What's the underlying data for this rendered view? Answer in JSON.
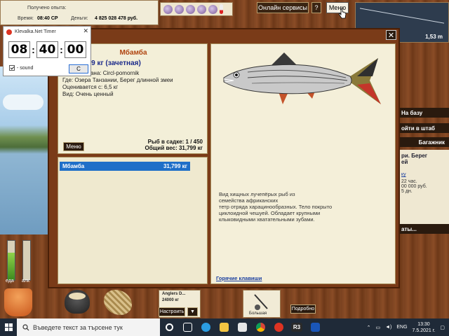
{
  "hud": {
    "experience_label": "Получено опыта:",
    "time_label": "Время:",
    "time_value": "08:40 СР",
    "money_label": "Деньги:",
    "money_value": "4 825 028 478 руб."
  },
  "topnav": {
    "online_services": "Онлайн сервисы",
    "help": "?",
    "menu": "Меню"
  },
  "minimap": {
    "depth": "1,53 m"
  },
  "right_panel": {
    "to_base": "На базу",
    "to_hq": "ойти в штаб",
    "trunk": "Багажник",
    "location_title": "ри. Берег",
    "location_title2": "ей",
    "link": "ку",
    "hours": "22 час.",
    "price": "00 000 руб.",
    "days": "5 дн.",
    "results": "аты..."
  },
  "timer": {
    "title": "Klevalka.Net Timer",
    "hours": "08",
    "minutes": "40",
    "seconds": "00",
    "sound_label": "- sound",
    "sound_checked": true,
    "reset_label": "C"
  },
  "fish_card": {
    "name": "Мбамба",
    "weight": "799 кг (зачетная)",
    "caught_by": "ймана: Circl-pomornik",
    "where": "Где: Озера Танзании, Берег длинной змеи",
    "valued_from": "Оценивается с: 6,5 кг",
    "kind": "Вид: Очень ценный",
    "menu_button": "Меню",
    "in_keepnet": "Рыб в садке: 1 / 450",
    "total_weight": "Общий вес: 31,799 кг"
  },
  "catch_list": [
    {
      "name": "Мбамба",
      "weight": "31,799 кг"
    }
  ],
  "description": {
    "text": "Вид хищных лучепёрых рыб из\nсемейства африканских\nтетр отряда харацинообразных. Тело покрыто\nциклоидной чешуей. Обладает крупными\nклыковидными хватательными зубами.",
    "hotkeys": "Горячие клавиши"
  },
  "bottom": {
    "food_label": "еда",
    "alc_label": "алк",
    "food_level": 0.7,
    "alc_level": 0.0,
    "slot_title": "Anglers D...",
    "slot_sub": "24000 кг",
    "configure": "Настроить",
    "more": "Подробно",
    "big_label": "Большая"
  },
  "taskbar": {
    "search_placeholder": "Въведете текст за търсене тук",
    "lang": "ENG",
    "time": "13:30",
    "date": "7.5.2021 г."
  },
  "colors": {
    "dialog_bg": "#7a3b18",
    "panel_bg": "#f3efd8",
    "fish_name": "#b0440f",
    "weight_text": "#1b2a8a",
    "selection": "#1f6fc8",
    "taskbar": "#1f2a38"
  }
}
